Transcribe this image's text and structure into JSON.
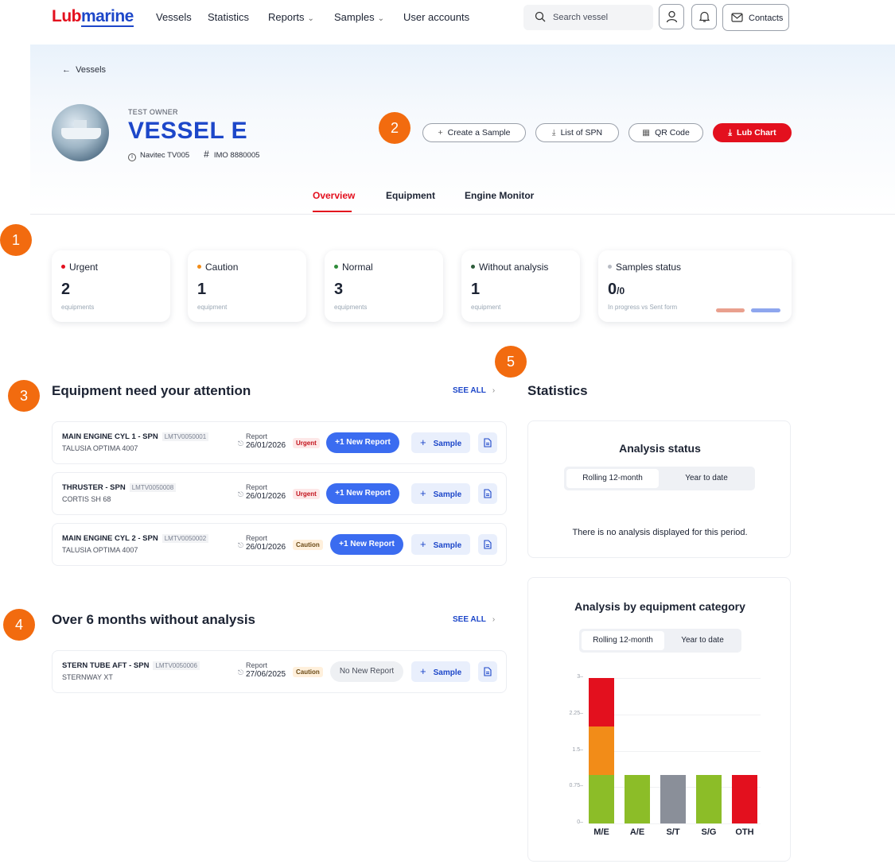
{
  "nav": {
    "logo_part1": "Lub",
    "logo_part2": "marine",
    "items": [
      {
        "label": "Vessels"
      },
      {
        "label": "Statistics"
      },
      {
        "label": "Reports"
      },
      {
        "label": "Samples"
      },
      {
        "label": "User accounts"
      }
    ],
    "search_placeholder": "Search vessel",
    "contacts_label": "Contacts"
  },
  "vessel": {
    "back_label": "Vessels",
    "owner": "TEST OWNER",
    "name": "VESSEL E",
    "code": "Navitec TV005",
    "imo": "IMO 8880005"
  },
  "actions": {
    "create_sample": "Create a Sample",
    "list_spn": "List of SPN",
    "qr_code": "QR Code",
    "lub_chart": "Lub Chart"
  },
  "tabs": [
    {
      "label": "Overview",
      "active": true
    },
    {
      "label": "Equipment",
      "active": false
    },
    {
      "label": "Engine Monitor",
      "active": false
    }
  ],
  "markers": [
    "1",
    "2",
    "3",
    "4",
    "5"
  ],
  "summary": [
    {
      "label": "Urgent",
      "value": "2",
      "unit": "equipments",
      "color": "#e3101e"
    },
    {
      "label": "Caution",
      "value": "1",
      "unit": "equipment",
      "color": "#f28c18"
    },
    {
      "label": "Normal",
      "value": "3",
      "unit": "equipments",
      "color": "#2e8b3a"
    },
    {
      "label": "Without analysis",
      "value": "1",
      "unit": "equipment",
      "color": "#2d5c3a"
    }
  ],
  "samples_status": {
    "label": "Samples status",
    "value": "0",
    "total": "/0",
    "sub": "In progress vs Sent form",
    "colors": [
      "#e9a08e",
      "#8ea6ee"
    ]
  },
  "attention": {
    "title": "Equipment need your attention",
    "see_all": "SEE ALL",
    "rows": [
      {
        "name": "MAIN ENGINE CYL 1 - SPN",
        "code": "LMTV0050001",
        "product": "TALUSIA OPTIMA 4007",
        "report_label": "Report",
        "date": "26/01/2026",
        "status": "Urgent",
        "new_report": "+1 New Report",
        "sample": "Sample"
      },
      {
        "name": "THRUSTER - SPN",
        "code": "LMTV0050008",
        "product": "CORTIS SH 68",
        "report_label": "Report",
        "date": "26/01/2026",
        "status": "Urgent",
        "new_report": "+1 New Report",
        "sample": "Sample"
      },
      {
        "name": "MAIN ENGINE CYL 2 - SPN",
        "code": "LMTV0050002",
        "product": "TALUSIA OPTIMA 4007",
        "report_label": "Report",
        "date": "26/01/2026",
        "status": "Caution",
        "new_report": "+1 New Report",
        "sample": "Sample"
      }
    ]
  },
  "without_analysis": {
    "title": "Over 6 months without analysis",
    "see_all": "SEE ALL",
    "rows": [
      {
        "name": "STERN TUBE AFT - SPN",
        "code": "LMTV0050006",
        "product": "STERNWAY XT",
        "report_label": "Report",
        "date": "27/06/2025",
        "status": "Caution",
        "new_report": "No New Report",
        "sample": "Sample"
      }
    ]
  },
  "statistics": {
    "title": "Statistics",
    "analysis_status": {
      "title": "Analysis status",
      "seg_on": "Rolling 12-month",
      "seg_off": "Year to date",
      "empty": "There is no analysis displayed for this period."
    },
    "by_category": {
      "title": "Analysis by equipment category",
      "seg_on": "Rolling 12-month",
      "seg_off": "Year to date"
    }
  },
  "chart_data": {
    "type": "bar",
    "stacked": true,
    "title": "Analysis by equipment category",
    "categories": [
      "M/E",
      "A/E",
      "S/T",
      "S/G",
      "OTH"
    ],
    "yticks": [
      "0",
      "0.75",
      "1.5",
      "2.25",
      "3"
    ],
    "ylim": [
      0,
      3
    ],
    "bars": [
      [
        {
          "value": 1,
          "color": "#8cbd28"
        },
        {
          "value": 1,
          "color": "#f28c18"
        },
        {
          "value": 1,
          "color": "#e3101e"
        }
      ],
      [
        {
          "value": 1,
          "color": "#8cbd28"
        }
      ],
      [
        {
          "value": 1,
          "color": "#8a8f99"
        }
      ],
      [
        {
          "value": 1,
          "color": "#8cbd28"
        }
      ],
      [
        {
          "value": 1,
          "color": "#e3101e"
        }
      ]
    ]
  }
}
